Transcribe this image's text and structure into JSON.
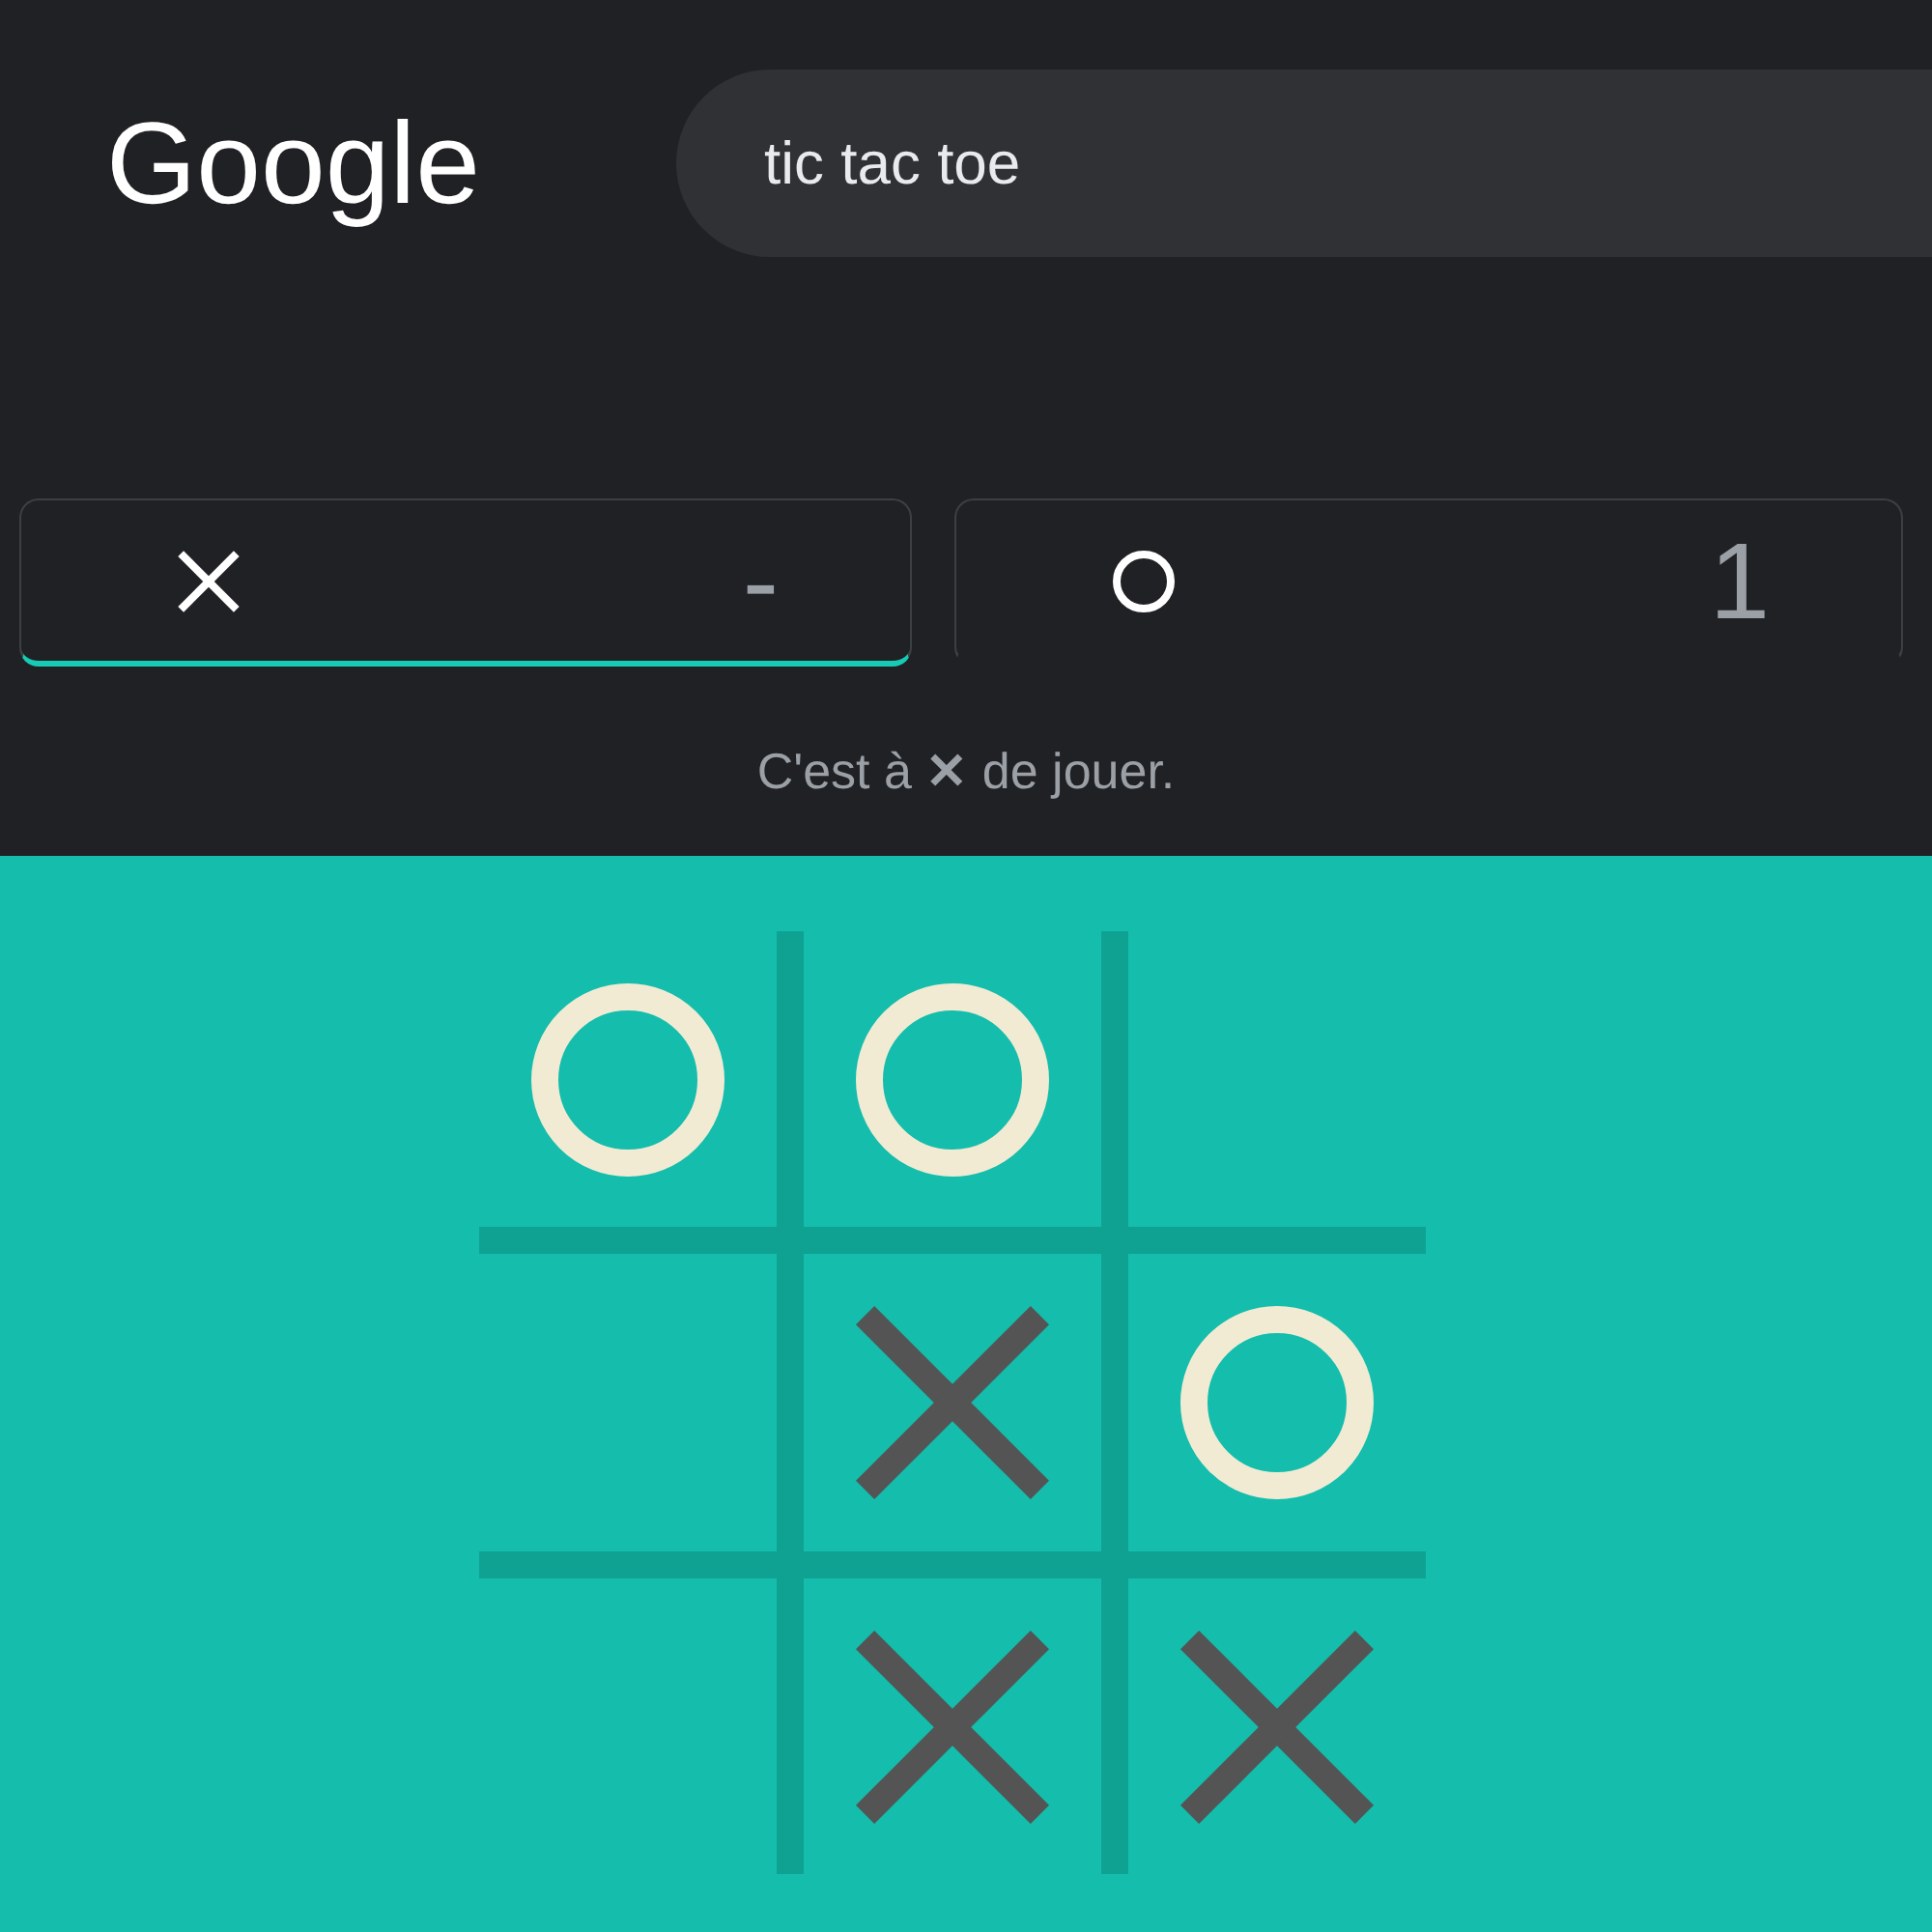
{
  "header": {
    "logo": "Google",
    "search": {
      "value": "tic tac toe"
    }
  },
  "score_cards": [
    {
      "kind": "x",
      "score": "-",
      "active": true
    },
    {
      "kind": "o",
      "score": "1",
      "active": false
    }
  ],
  "status": "C'est à **✕** de jouer.",
  "board": {
    "rows": [
      {
        "cells": [
          {
            "kind": "o"
          },
          {
            "kind": "o"
          },
          {
            "kind": "empty"
          }
        ]
      },
      {
        "cells": [
          {
            "kind": "empty"
          },
          {
            "kind": "x"
          },
          {
            "kind": "o"
          }
        ]
      },
      {
        "cells": [
          {
            "kind": "empty"
          },
          {
            "kind": "x"
          },
          {
            "kind": "x"
          }
        ]
      }
    ]
  }
}
